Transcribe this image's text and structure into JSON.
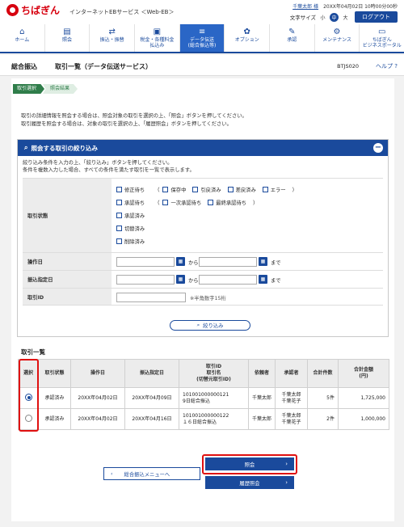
{
  "header": {
    "logo_text": "ちばぎん",
    "service": "インターネットEBサービス ＜Web-EB＞",
    "user": "千葉太郎 様",
    "last_login": "20XX年04月02日 10時00分00秒",
    "font_size_label": "文字サイズ",
    "font_sizes": [
      "小",
      "中",
      "大"
    ],
    "logout": "ログアウト"
  },
  "nav": [
    {
      "icon": "home-icon",
      "glyph": "⌂",
      "label": "ホーム"
    },
    {
      "icon": "document-icon",
      "glyph": "▤",
      "label": "照会"
    },
    {
      "icon": "transfer-icon",
      "glyph": "⇄",
      "label": "振込・振替"
    },
    {
      "icon": "folder-icon",
      "glyph": "▣",
      "label": "税金・各種料金\n払込み"
    },
    {
      "icon": "database-icon",
      "glyph": "≡",
      "label": "データ伝送\n(総合振込等)"
    },
    {
      "icon": "option-icon",
      "glyph": "✿",
      "label": "オプション"
    },
    {
      "icon": "approval-icon",
      "glyph": "✎",
      "label": "承認"
    },
    {
      "icon": "maintenance-icon",
      "glyph": "⚙",
      "label": "メンテナンス"
    },
    {
      "icon": "portal-icon",
      "glyph": "▭",
      "label": "ちばぎん\nビジネスポータル"
    }
  ],
  "title": {
    "main": "総合振込",
    "sub": "取引一覧（データ伝送サービス）",
    "code": "BTJS020",
    "help": "ヘルプ ?"
  },
  "steps": [
    "取引選択",
    "照会結果"
  ],
  "intro": [
    "取引の詳細情報を照会する場合は、照会対象の取引を選択の上、「照会」ボタンを押してください。",
    "取引履歴を照会する場合は、対象の取引を選択の上、「履歴照会」ボタンを押してください。"
  ],
  "filter": {
    "title": "照会する取引の絞り込み",
    "collapse": "−",
    "desc": [
      "絞り込み条件を入力の上、「絞り込み」ボタンを押してください。",
      "条件を複数入力した場合、すべての条件を満たす取引を一覧で表示します。"
    ],
    "status_label": "取引状態",
    "status_row1": [
      "修正待ち",
      "保存中",
      "引戻済み",
      "差戻済み",
      "エラー"
    ],
    "status_row2": [
      "承認待ち",
      "一次承認待ち",
      "最終承認待ち"
    ],
    "status_other": [
      "承認済み",
      "切替済み",
      "削除済み"
    ],
    "paren_open": "（",
    "paren_close": "）",
    "op_date_label": "操作日",
    "transfer_date_label": "振込指定日",
    "id_label": "取引ID",
    "from": "から",
    "to": "まで",
    "id_hint": "※半角数字15桁",
    "filter_button": "絞り込み"
  },
  "list": {
    "title": "取引一覧",
    "headers": [
      "選択",
      "取引状態",
      "操作日",
      "振込指定日",
      "取引ID\n取引名\n(切替元取引ID)",
      "依頼者",
      "承認者",
      "合計件数",
      "合計金額\n(円)"
    ],
    "rows": [
      {
        "status": "承認済み",
        "op_date": "20XX年04月02日",
        "transfer_date": "20XX年04月09日",
        "id": "101001000000121\n9日総合振込",
        "requester": "千葉太郎",
        "approver": "千葉太郎\n千葉花子",
        "count": "5件",
        "amount": "1,725,000",
        "selected": true
      },
      {
        "status": "承認済み",
        "op_date": "20XX年04月02日",
        "transfer_date": "20XX年04月16日",
        "id": "101001000000122\n１６日総合振込",
        "requester": "千葉太郎",
        "approver": "千葉太郎\n千葉花子",
        "count": "2件",
        "amount": "1,000,000",
        "selected": false
      }
    ]
  },
  "actions": {
    "back": "総合振込メニューへ",
    "inquiry": "照会",
    "history": "履歴照会"
  }
}
